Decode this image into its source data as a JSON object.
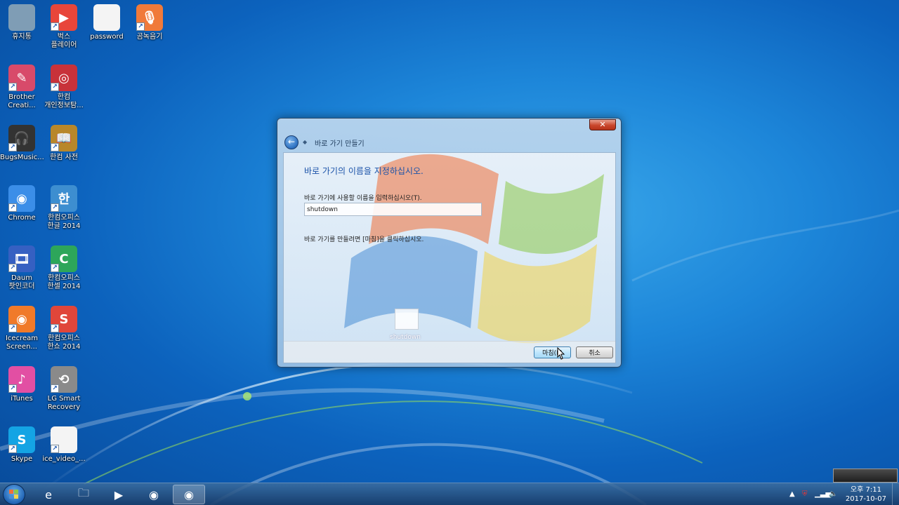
{
  "desktop": {
    "icons": [
      {
        "label": "휴지통",
        "glyph": "",
        "color": "#7f9db5"
      },
      {
        "label": "벅스\n플레이어",
        "glyph": "▶",
        "color": "#e8463a"
      },
      {
        "label": "password",
        "glyph": "",
        "color": "#f4f4f4"
      },
      {
        "label": "곰녹음기",
        "glyph": "🎙",
        "color": "#f07a3a"
      },
      {
        "label": "Brother\nCreati...",
        "glyph": "✎",
        "color": "#d84a6a"
      },
      {
        "label": "한컴\n개인정보탐...",
        "glyph": "◎",
        "color": "#c8323a"
      },
      {
        "label": "BugsMusic...",
        "glyph": "🎧",
        "color": "#333333"
      },
      {
        "label": "한컴 사전",
        "glyph": "📖",
        "color": "#b8872a"
      },
      {
        "label": "Chrome",
        "glyph": "◉",
        "color": "#3b8ee8"
      },
      {
        "label": "한컴오피스\n한글 2014",
        "glyph": "한",
        "color": "#3d8ed0"
      },
      {
        "label": "Daum\n팟인코더",
        "glyph": "🎞",
        "color": "#3660c2"
      },
      {
        "label": "한컴오피스\n한셀 2014",
        "glyph": "C",
        "color": "#2da65a"
      },
      {
        "label": "Icecream\nScreen...",
        "glyph": "◉",
        "color": "#f07a2a"
      },
      {
        "label": "한컴오피스\n한쇼 2014",
        "glyph": "S",
        "color": "#e0463a"
      },
      {
        "label": "iTunes",
        "glyph": "♪",
        "color": "#e24fa3"
      },
      {
        "label": "LG Smart\nRecovery",
        "glyph": "⟲",
        "color": "#8a8a8a"
      },
      {
        "label": "Skype",
        "glyph": "S",
        "color": "#14a4e4"
      },
      {
        "label": "ice_video_...",
        "glyph": "",
        "color": "#f4f4f4"
      }
    ]
  },
  "dialog": {
    "title": "바로 가기 만들기",
    "close_glyph": "✕",
    "back_glyph": "←",
    "heading": "바로 가기의 이름을 지정하십시오.",
    "name_prompt": "바로 가기에 사용할 이름을 입력하십시오(T).",
    "name_value": "shutdown",
    "hint": "바로 가기를 만들려면 [마침]을 클릭하십시오.",
    "preview_label": "shutdown",
    "finish_label": "마침(F)",
    "cancel_label": "취소"
  },
  "taskbar": {
    "items": [
      {
        "name": "ie",
        "glyph": "e"
      },
      {
        "name": "explorer",
        "glyph": "🗀"
      },
      {
        "name": "media-player",
        "glyph": "▶"
      },
      {
        "name": "chrome",
        "glyph": "◉"
      },
      {
        "name": "icecream",
        "glyph": "◉"
      }
    ],
    "tray": {
      "expand_glyph": "▲",
      "time": "오후 7:11",
      "date": "2017-10-07"
    }
  }
}
